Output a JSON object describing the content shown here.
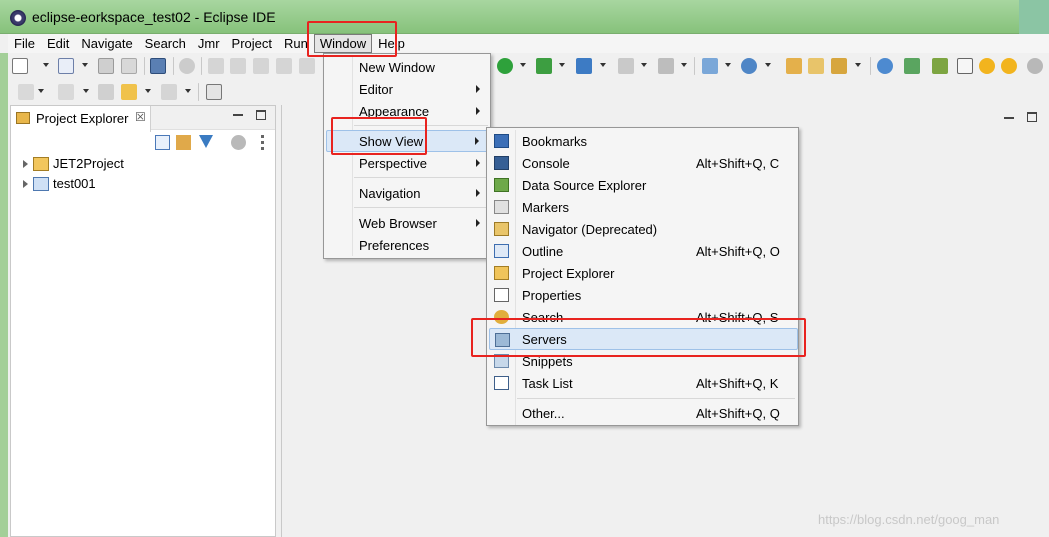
{
  "window": {
    "title": "eclipse-eorkspace_test02 - Eclipse IDE"
  },
  "menubar": {
    "items": [
      "File",
      "Edit",
      "Navigate",
      "Search",
      "Jmr",
      "Project",
      "Run",
      "Window",
      "Help"
    ],
    "active": "Window"
  },
  "explorer": {
    "tab_label": "Project Explorer",
    "close_glyph": "☒",
    "projects": [
      "JET2Project",
      "test001"
    ]
  },
  "window_menu": {
    "items": [
      {
        "label": "New Window",
        "submenu": false
      },
      {
        "label": "Editor",
        "submenu": true
      },
      {
        "label": "Appearance",
        "submenu": true
      },
      {
        "label": "Show View",
        "submenu": true
      },
      {
        "label": "Perspective",
        "submenu": true
      },
      {
        "label": "Navigation",
        "submenu": true
      },
      {
        "label": "Web Browser",
        "submenu": true
      },
      {
        "label": "Preferences",
        "submenu": false
      }
    ],
    "highlighted": "Show View"
  },
  "show_view_menu": {
    "items": [
      {
        "label": "Bookmarks",
        "shortcut": "",
        "icon": "bookmarks-icon"
      },
      {
        "label": "Console",
        "shortcut": "Alt+Shift+Q, C",
        "icon": "console-icon"
      },
      {
        "label": "Data Source Explorer",
        "shortcut": "",
        "icon": "data-source-icon"
      },
      {
        "label": "Markers",
        "shortcut": "",
        "icon": "markers-icon"
      },
      {
        "label": "Navigator (Deprecated)",
        "shortcut": "",
        "icon": "navigator-icon"
      },
      {
        "label": "Outline",
        "shortcut": "Alt+Shift+Q, O",
        "icon": "outline-icon"
      },
      {
        "label": "Project Explorer",
        "shortcut": "",
        "icon": "project-explorer-icon"
      },
      {
        "label": "Properties",
        "shortcut": "",
        "icon": "properties-icon"
      },
      {
        "label": "Search",
        "shortcut": "Alt+Shift+Q, S",
        "icon": "search-icon"
      },
      {
        "label": "Servers",
        "shortcut": "",
        "icon": "servers-icon"
      },
      {
        "label": "Snippets",
        "shortcut": "",
        "icon": "snippets-icon"
      },
      {
        "label": "Task List",
        "shortcut": "Alt+Shift+Q, K",
        "icon": "task-list-icon"
      },
      {
        "label": "Other...",
        "shortcut": "Alt+Shift+Q, Q",
        "icon": ""
      }
    ],
    "highlighted": "Servers"
  },
  "colors": {
    "annotation_red": "#e8231f",
    "menu_highlight": "#dbe8f7",
    "titlebar_green": "#9fd095"
  },
  "watermark": "https://blog.csdn.net/goog_man"
}
